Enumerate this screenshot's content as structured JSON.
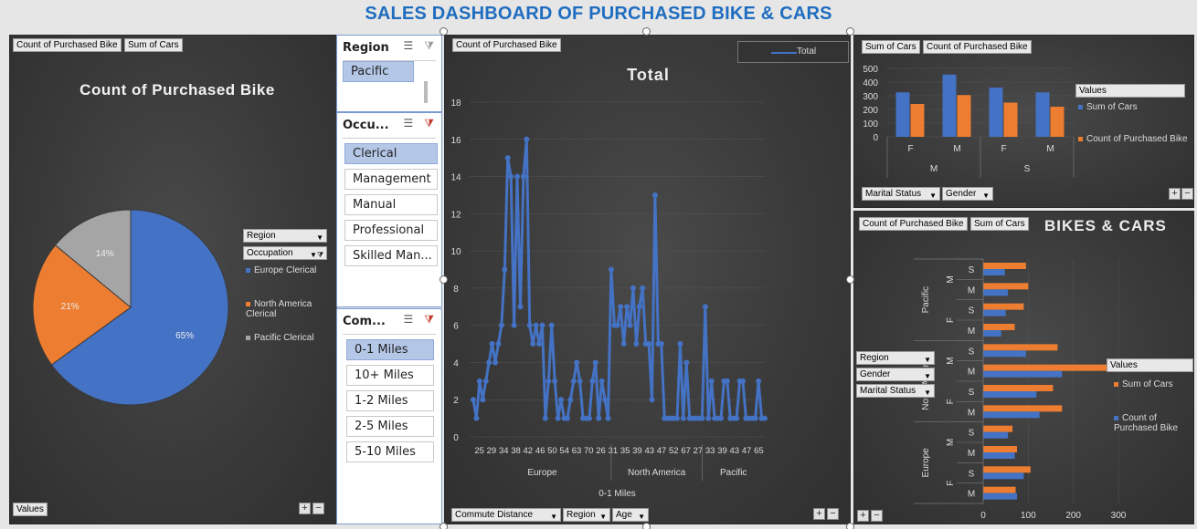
{
  "title": "SALES DASHBOARD OF PURCHASED BIKE & CARS",
  "colors": {
    "blue": "#4472c4",
    "orange": "#ed7d31",
    "gray": "#a5a5a5",
    "title_blue": "#1f6dc0"
  },
  "pie_panel": {
    "field_buttons": [
      "Count of Purchased Bike",
      "Sum of Cars"
    ],
    "values_button": "Values",
    "region_button": "Region",
    "occupation_button": "Occupation"
  },
  "slicers": {
    "region": {
      "header": "Region",
      "items": [
        "Pacific"
      ],
      "selected": [
        0
      ]
    },
    "occupation": {
      "header": "Occu...",
      "items": [
        "Clerical",
        "Management",
        "Manual",
        "Professional",
        "Skilled Man..."
      ],
      "selected": [
        0
      ]
    },
    "commute": {
      "header": "Com...",
      "items": [
        "0-1 Miles",
        "10+ Miles",
        "1-2 Miles",
        "2-5 Miles",
        "5-10 Miles"
      ],
      "selected": [
        0
      ]
    }
  },
  "line_panel": {
    "field_button": "Count of Purchased Bike",
    "filter_buttons": [
      "Commute Distance",
      "Region",
      "Age"
    ]
  },
  "bar_panel": {
    "field_buttons": [
      "Sum of Cars",
      "Count of Purchased Bike"
    ],
    "filter_buttons": [
      "Marital Status",
      "Gender"
    ]
  },
  "hbar_panel": {
    "field_buttons": [
      "Count of Purchased Bike",
      "Sum of Cars"
    ],
    "filter_buttons": [
      "Region",
      "Gender",
      "Marital Status"
    ]
  },
  "chart_data": [
    {
      "type": "pie",
      "title": "Count of Purchased Bike",
      "legend_header": [
        "Region",
        "Occupation"
      ],
      "slices": [
        {
          "label": "Europe Clerical",
          "value": 65,
          "display": "65%",
          "color": "#4472c4"
        },
        {
          "label": "North America Clerical",
          "value": 21,
          "display": "21%",
          "color": "#ed7d31"
        },
        {
          "label": "Pacific Clerical",
          "value": 14,
          "display": "14%",
          "color": "#a5a5a5"
        }
      ]
    },
    {
      "type": "line",
      "title": "Total",
      "legend": [
        "Total"
      ],
      "ylim": [
        0,
        18
      ],
      "yticks": [
        0,
        2,
        4,
        6,
        8,
        10,
        12,
        14,
        16,
        18
      ],
      "xlabel": "0-1 Miles",
      "x_tick_labels": [
        "25",
        "29",
        "34",
        "38",
        "42",
        "46",
        "50",
        "54",
        "63",
        "70",
        "26",
        "31",
        "35",
        "39",
        "43",
        "47",
        "52",
        "67",
        "27",
        "33",
        "39",
        "43",
        "47",
        "65"
      ],
      "groups": [
        {
          "name": "Europe",
          "from": 0,
          "to": 44
        },
        {
          "name": "North America",
          "from": 44,
          "to": 73
        },
        {
          "name": "Pacific",
          "from": 73,
          "to": 94
        }
      ],
      "series": [
        {
          "name": "Total",
          "values": [
            2,
            1,
            3,
            2,
            3,
            4,
            5,
            4,
            5,
            6,
            9,
            15,
            14,
            6,
            14,
            7,
            14,
            16,
            6,
            5,
            6,
            5,
            6,
            1,
            3,
            6,
            3,
            1,
            2,
            1,
            1,
            2,
            3,
            4,
            3,
            1,
            1,
            1,
            3,
            4,
            1,
            3,
            2,
            1,
            9,
            6,
            6,
            7,
            5,
            7,
            6,
            8,
            5,
            7,
            8,
            5,
            5,
            2,
            13,
            5,
            5,
            1,
            1,
            1,
            1,
            1,
            5,
            1,
            4,
            1,
            1,
            1,
            1,
            1,
            7,
            1,
            3,
            1,
            1,
            1,
            3,
            3,
            1,
            1,
            1,
            3,
            3,
            1,
            1,
            1,
            1,
            3,
            1,
            1
          ]
        }
      ]
    },
    {
      "type": "bar",
      "legend_title": "Values",
      "categories": [
        "F",
        "M",
        "F",
        "M"
      ],
      "groups": [
        "M",
        "S"
      ],
      "ylim": [
        0,
        500
      ],
      "yticks": [
        0,
        100,
        200,
        300,
        400,
        500
      ],
      "series": [
        {
          "name": "Sum of Cars",
          "values": [
            325,
            455,
            360,
            325
          ]
        },
        {
          "name": "Count of Purchased Bike",
          "values": [
            240,
            305,
            250,
            220
          ]
        }
      ]
    },
    {
      "type": "bar",
      "orientation": "horizontal",
      "title": "BIKES & CARS",
      "legend_title": "Values",
      "xlim": [
        0,
        300
      ],
      "xticks": [
        0,
        100,
        200,
        300
      ],
      "regions": [
        "Pacific",
        "North America",
        "Europe"
      ],
      "genders": [
        "M",
        "F"
      ],
      "statuses": [
        "S",
        "M"
      ],
      "series": [
        {
          "name": "Sum of Cars",
          "values": [
            95,
            100,
            90,
            70,
            165,
            290,
            155,
            175,
            65,
            75,
            105,
            72
          ]
        },
        {
          "name": "Count of Purchased Bike",
          "values": [
            48,
            55,
            50,
            40,
            95,
            175,
            118,
            125,
            55,
            70,
            90,
            75
          ]
        }
      ]
    }
  ]
}
